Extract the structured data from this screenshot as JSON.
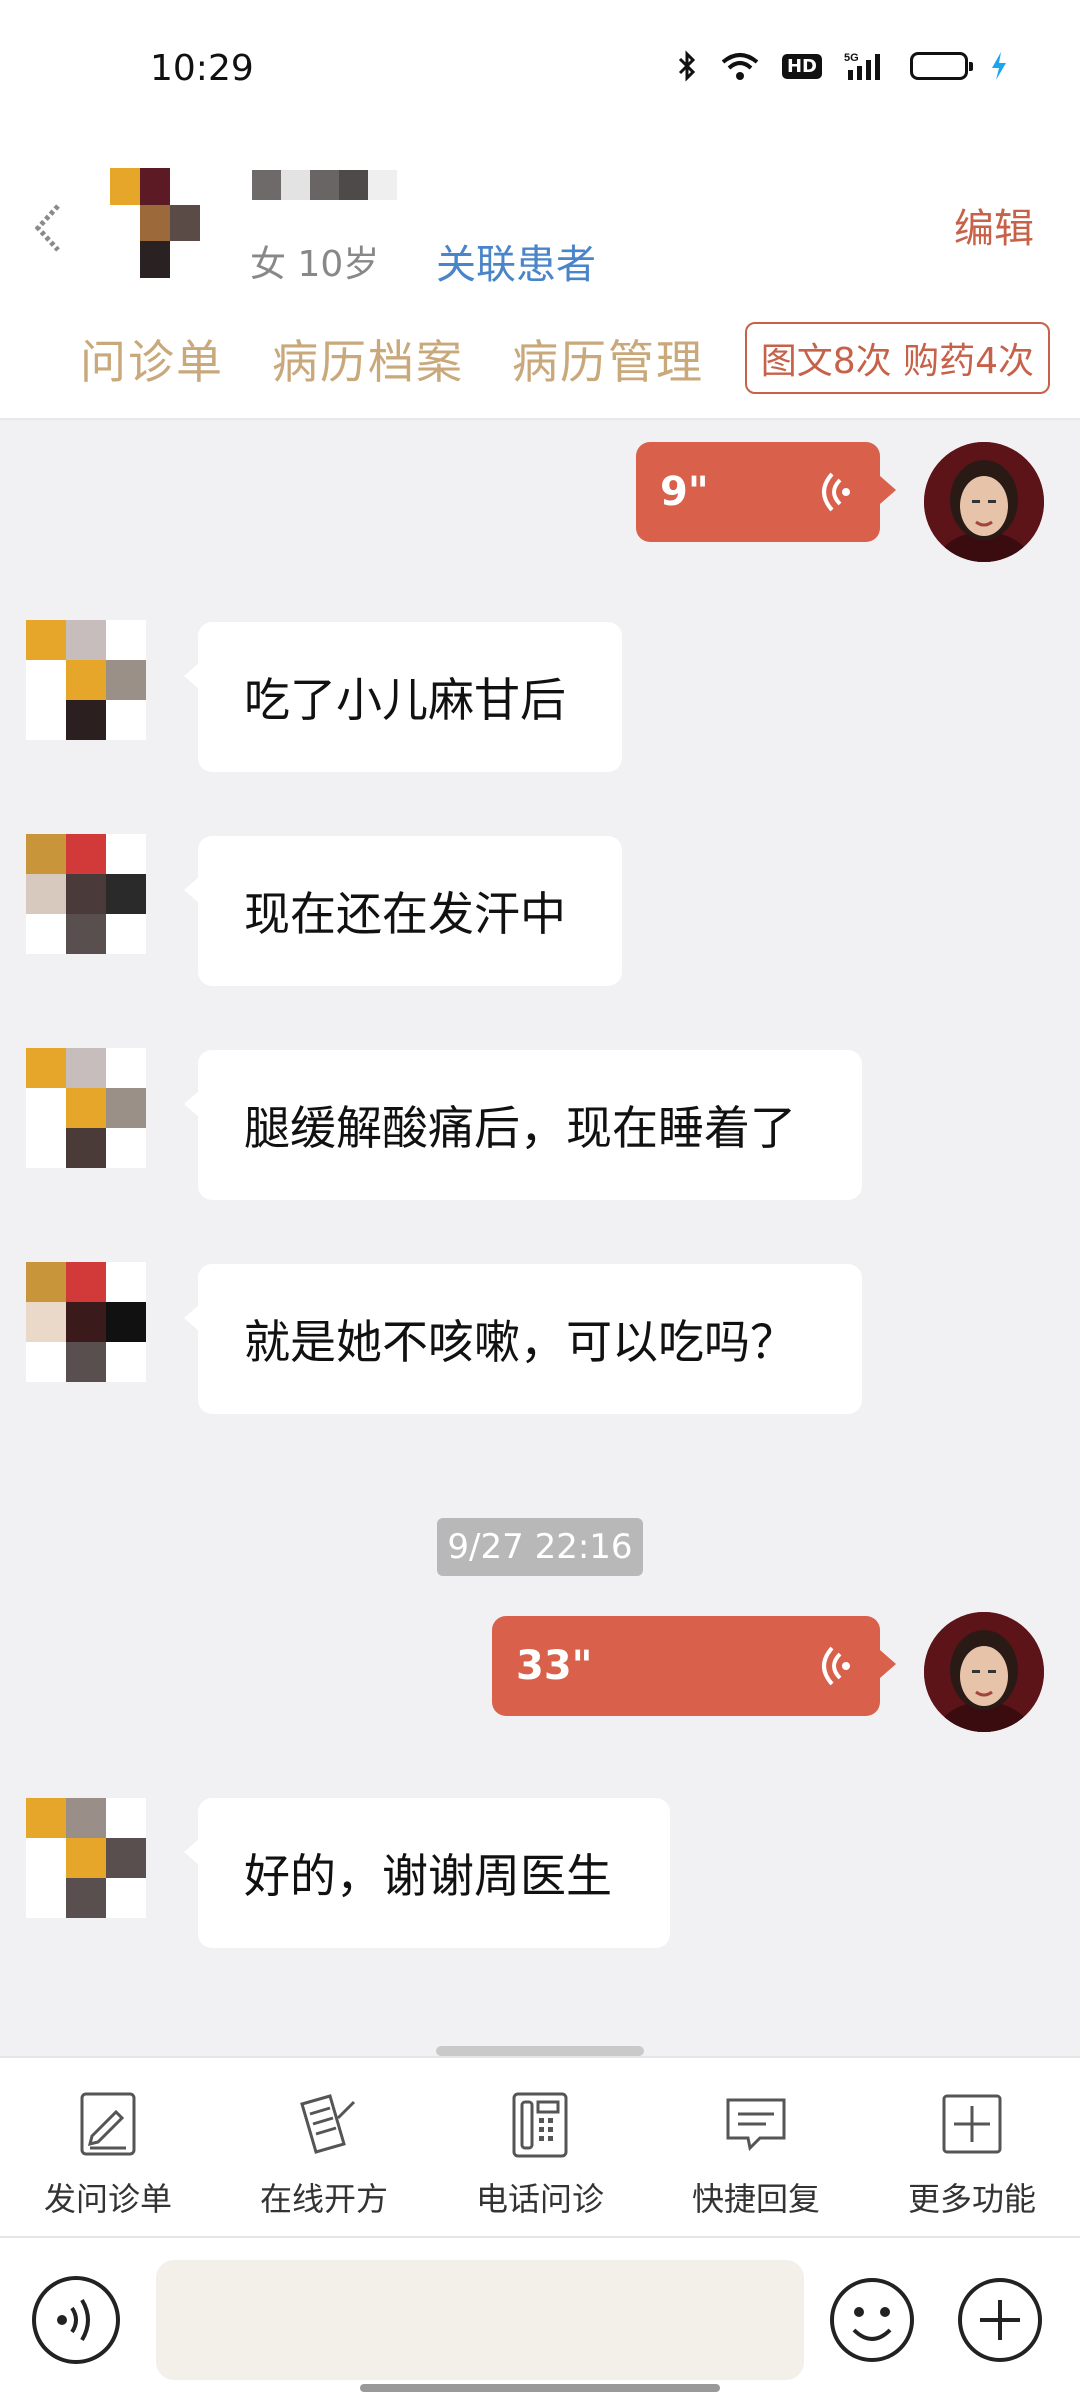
{
  "status_bar": {
    "time": "10:29",
    "network": "5G",
    "hd": "HD"
  },
  "header": {
    "patient_info": "女 10岁",
    "link_patient": "关联患者",
    "edit": "编辑",
    "tabs": [
      "问诊单",
      "病历档案",
      "病历管理"
    ],
    "summary_badge": "图文8次 购药4次"
  },
  "messages": {
    "voice_1": "9\"",
    "text_1": "吃了小儿麻甘后",
    "text_2": "现在还在发汗中",
    "text_3": "腿缓解酸痛后，现在睡着了",
    "text_4": "就是她不咳嗽，可以吃吗？",
    "timestamp": "9/27 22:16",
    "voice_2": "33\"",
    "text_5": "好的，谢谢周医生"
  },
  "toolbar": [
    "发问诊单",
    "在线开方",
    "电话问诊",
    "快捷回复",
    "更多功能"
  ],
  "colors": {
    "accent": "#d9604a",
    "tab": "#c9a97b",
    "link": "#4a84c9"
  }
}
